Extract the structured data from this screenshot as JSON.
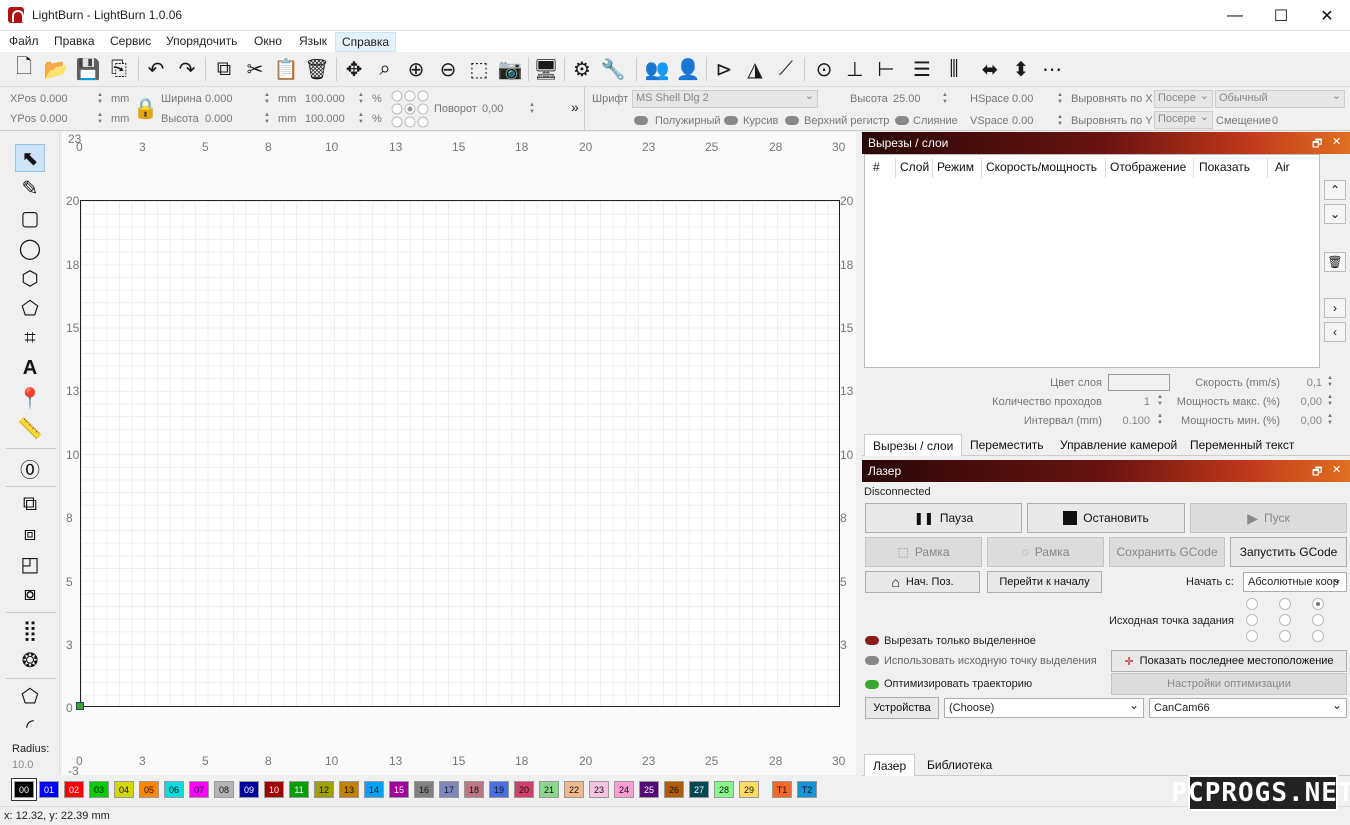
{
  "window": {
    "title": "LightBurn - LightBurn 1.0.06",
    "minimize": "—",
    "maximize": "☐",
    "close": "✕"
  },
  "menu": [
    "Файл",
    "Правка",
    "Сервис",
    "Упорядочить",
    "Окно",
    "Язык",
    "Справка"
  ],
  "props": {
    "xpos_label": "XPos",
    "xpos_value": "0.000",
    "ypos_label": "YPos",
    "ypos_value": "0.000",
    "unit": "mm",
    "width_label": "Ширина",
    "width_value": "0.000",
    "height_label": "Высота",
    "height_value": "0.000",
    "scale_x": "100.000",
    "scale_y": "100.000",
    "percent": "%",
    "rotate_label": "Поворот",
    "rotate_value": "0,00",
    "more": "»",
    "font_label": "Шрифт",
    "font_value": "MS Shell Dlg 2",
    "text_height_label": "Высота",
    "text_height_value": "25.00",
    "hspace_label": "HSpace",
    "hspace_value": "0.00",
    "vspace_label": "VSpace",
    "vspace_value": "0.00",
    "align_x_label": "Выровнять по X",
    "align_x_value": "Посере",
    "align_y_label": "Выровнять по Y",
    "align_y_value": "Посере",
    "style_value": "Обычный",
    "offset_label": "Смещение",
    "offset_value": "0",
    "bold_label": "Полужирный",
    "italic_label": "Курсив",
    "upper_label": "Верхний регистр",
    "merge_label": "Слияние"
  },
  "left_tools": {
    "radius_label": "Radius:",
    "radius_value": "10.0"
  },
  "ruler": {
    "top": [
      "0",
      "3",
      "5",
      "8",
      "10",
      "13",
      "15",
      "18",
      "20",
      "23",
      "25",
      "28",
      "30"
    ],
    "left": [
      "20",
      "18",
      "15",
      "13",
      "10",
      "8",
      "5",
      "3",
      "0"
    ],
    "corner_top": "23",
    "corner_bottom": "-3"
  },
  "cuts_panel": {
    "title": "Вырезы / слои",
    "columns": [
      "#",
      "Слой",
      "Режим",
      "Скорость/мощность",
      "Отображение",
      "Показать",
      "Air"
    ],
    "layer_color_label": "Цвет слоя",
    "speed_label": "Скорость (mm/s)",
    "speed_value": "0,1",
    "passes_label": "Количество проходов",
    "passes_value": "1",
    "max_power_label": "Мощность макс. (%)",
    "max_power_value": "0,00",
    "interval_label": "Интервал (mm)",
    "interval_value": "0.100",
    "min_power_label": "Мощность мин. (%)",
    "min_power_value": "0,00",
    "tabs": [
      "Вырезы / слои",
      "Переместить",
      "Управление камерой",
      "Переменный текст"
    ]
  },
  "laser_panel": {
    "title": "Лазер",
    "status": "Disconnected",
    "pause": "Пауза",
    "stop": "Остановить",
    "start": "Пуск",
    "frame1": "Рамка",
    "frame2": "Рамка",
    "save_gcode": "Сохранить GCode",
    "run_gcode": "Запустить GCode",
    "home": "Нач. Поз.",
    "go_origin": "Перейти к началу",
    "start_from_label": "Начать с:",
    "start_from_value": "Абсолютные коор",
    "job_origin_label": "Исходная точка задания",
    "cut_selected": "Вырезать только выделенное",
    "use_origin": "Использовать исходную точку выделения",
    "optimize": "Оптимизировать траекторию",
    "show_last": "Показать последнее местоположение",
    "opt_settings": "Настройки оптимизации",
    "devices": "Устройства",
    "device_value": "(Choose)",
    "port_value": "CanCam66",
    "tabs": [
      "Лазер",
      "Библиотека"
    ]
  },
  "palette": [
    {
      "label": "00",
      "color": "#000000"
    },
    {
      "label": "01",
      "color": "#0000ff"
    },
    {
      "label": "02",
      "color": "#ff0000"
    },
    {
      "label": "03",
      "color": "#00cc00"
    },
    {
      "label": "04",
      "color": "#d6d600"
    },
    {
      "label": "05",
      "color": "#ff8800"
    },
    {
      "label": "06",
      "color": "#00dddd"
    },
    {
      "label": "07",
      "color": "#ff00ff"
    },
    {
      "label": "08",
      "color": "#b4b4b4"
    },
    {
      "label": "09",
      "color": "#0000a0"
    },
    {
      "label": "10",
      "color": "#a00000"
    },
    {
      "label": "11",
      "color": "#00a000"
    },
    {
      "label": "12",
      "color": "#a0a000"
    },
    {
      "label": "13",
      "color": "#c08000"
    },
    {
      "label": "14",
      "color": "#00a0ff"
    },
    {
      "label": "15",
      "color": "#a000a0"
    },
    {
      "label": "16",
      "color": "#808080"
    },
    {
      "label": "17",
      "color": "#7d87b9"
    },
    {
      "label": "18",
      "color": "#bb7784"
    },
    {
      "label": "19",
      "color": "#4a6fe3"
    },
    {
      "label": "20",
      "color": "#d33f6a"
    },
    {
      "label": "21",
      "color": "#8cd78c"
    },
    {
      "label": "22",
      "color": "#f0b98d"
    },
    {
      "label": "23",
      "color": "#f6c4e1"
    },
    {
      "label": "24",
      "color": "#fa9ed4"
    },
    {
      "label": "25",
      "color": "#500a78"
    },
    {
      "label": "26",
      "color": "#b45a00"
    },
    {
      "label": "27",
      "color": "#004754"
    },
    {
      "label": "28",
      "color": "#86fa88"
    },
    {
      "label": "29",
      "color": "#ffdb66"
    },
    {
      "label": "T1",
      "color": "#f36926"
    },
    {
      "label": "T2",
      "color": "#0c95d7"
    }
  ],
  "status": {
    "coords": "x: 12.32, y: 22.39 mm"
  },
  "watermark": "PCPROGS.NET"
}
